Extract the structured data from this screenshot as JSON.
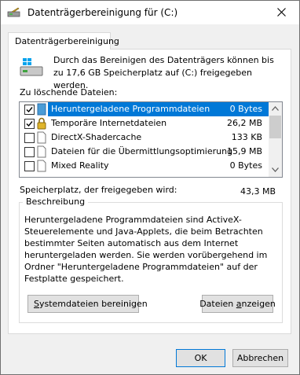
{
  "window": {
    "title": "Datenträgerbereinigung für  (C:)",
    "close_icon": "close-icon"
  },
  "tab": {
    "label": "Datenträgerbereinigung"
  },
  "intro": {
    "text": "Durch das Bereinigen des Datenträgers können bis zu 17,6 GB Speicherplatz auf  (C:) freigegeben werden."
  },
  "files_label": "Zu löschende Dateien:",
  "files": [
    {
      "name": "Heruntergeladene Programmdateien",
      "size": "0 Bytes",
      "checked": true,
      "selected": true,
      "icon": "folder-icon"
    },
    {
      "name": "Temporäre Internetdateien",
      "size": "26,2 MB",
      "checked": true,
      "selected": false,
      "icon": "lock-icon"
    },
    {
      "name": "DirectX-Shadercache",
      "size": "133 KB",
      "checked": false,
      "selected": false,
      "icon": "file-icon"
    },
    {
      "name": "Dateien für die Übermittlungsoptimierung",
      "size": "15,9 MB",
      "checked": false,
      "selected": false,
      "icon": "file-icon"
    },
    {
      "name": "Mixed Reality",
      "size": "0 Bytes",
      "checked": false,
      "selected": false,
      "icon": "file-icon"
    }
  ],
  "space": {
    "label": "Speicherplatz, der freigegeben wird:",
    "value": "43,3 MB"
  },
  "description": {
    "legend": "Beschreibung",
    "text": "Heruntergeladene Programmdateien sind ActiveX-Steuerelemente und Java-Applets, die beim Betrachten bestimmter Seiten automatisch aus dem Internet heruntergeladen werden. Sie werden vorübergehend im Ordner \"Heruntergeladene Programmdateien\" auf der Festplatte gespeichert."
  },
  "buttons": {
    "system_prefix": "S",
    "system_rest": "ystemdateien bereinigen",
    "view_prefix": "Dateien ",
    "view_underline": "a",
    "view_rest": "nzeigen",
    "ok": "OK",
    "cancel": "Abbrechen"
  },
  "colors": {
    "selection": "#0078d7",
    "accent_border": "#0078d7"
  }
}
